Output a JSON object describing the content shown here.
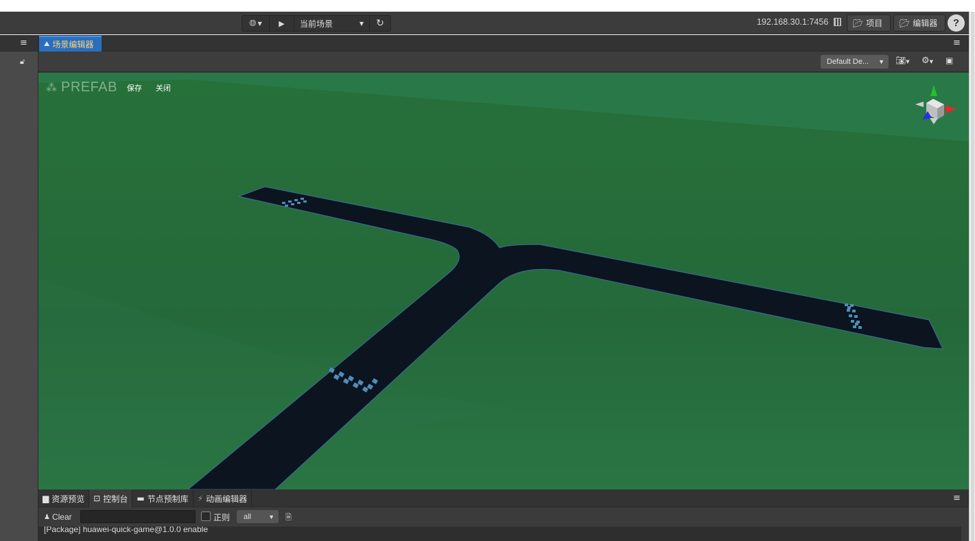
{
  "toolbar": {
    "scene_select": "当前场景",
    "ip_address": "192.168.30.1:7456",
    "project_button": "项目",
    "editor_button": "编辑器",
    "help_label": "?"
  },
  "scene_panel": {
    "tab_label": "场景编辑器",
    "design_resolution": "Default De...",
    "prefab": {
      "title": "PREFAB",
      "save_label": "保存",
      "close_label": "关闭"
    }
  },
  "bottom_panel": {
    "tabs": [
      {
        "label": "资源预览",
        "icon": "folder-icon"
      },
      {
        "label": "控制台",
        "icon": "console-icon"
      },
      {
        "label": "节点预制库",
        "icon": "library-icon"
      },
      {
        "label": "动画编辑器",
        "icon": "animation-icon"
      }
    ],
    "clear_label": "Clear",
    "search_value": "",
    "regex_label": "正则",
    "level_select": "all",
    "log_lines": [
      "[Package] huawei-quick-game@1.0.0 enable"
    ]
  },
  "colors": {
    "ground": "#25713a",
    "road": "#0c141f",
    "accent_tab": "#2a6fbf",
    "tab_text": "#ffd27a"
  }
}
